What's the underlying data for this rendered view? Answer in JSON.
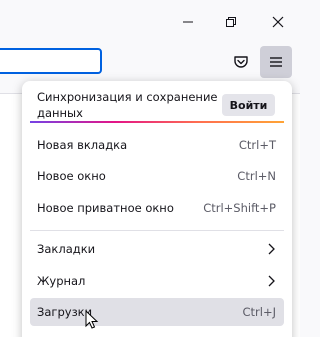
{
  "window_controls": {
    "minimize": "minimize-icon",
    "restore": "restore-icon",
    "close": "close-icon"
  },
  "toolbar": {
    "pocket_icon": "pocket-icon",
    "menu_icon": "hamburger-menu-icon"
  },
  "menu": {
    "sync_text": "Синхронизация и сохранение данных",
    "sign_in_label": "Войти",
    "items": [
      {
        "label": "Новая вкладка",
        "shortcut": "Ctrl+T"
      },
      {
        "label": "Новое окно",
        "shortcut": "Ctrl+N"
      },
      {
        "label": "Новое приватное окно",
        "shortcut": "Ctrl+Shift+P"
      },
      {
        "label": "Закладки",
        "shortcut": ""
      },
      {
        "label": "Журнал",
        "shortcut": ""
      },
      {
        "label": "Загрузки",
        "shortcut": "Ctrl+J"
      }
    ]
  },
  "colors": {
    "accent": "#0061e0",
    "menu_button_active": "#cfcfd8",
    "hover_row": "#e0e0e6"
  }
}
